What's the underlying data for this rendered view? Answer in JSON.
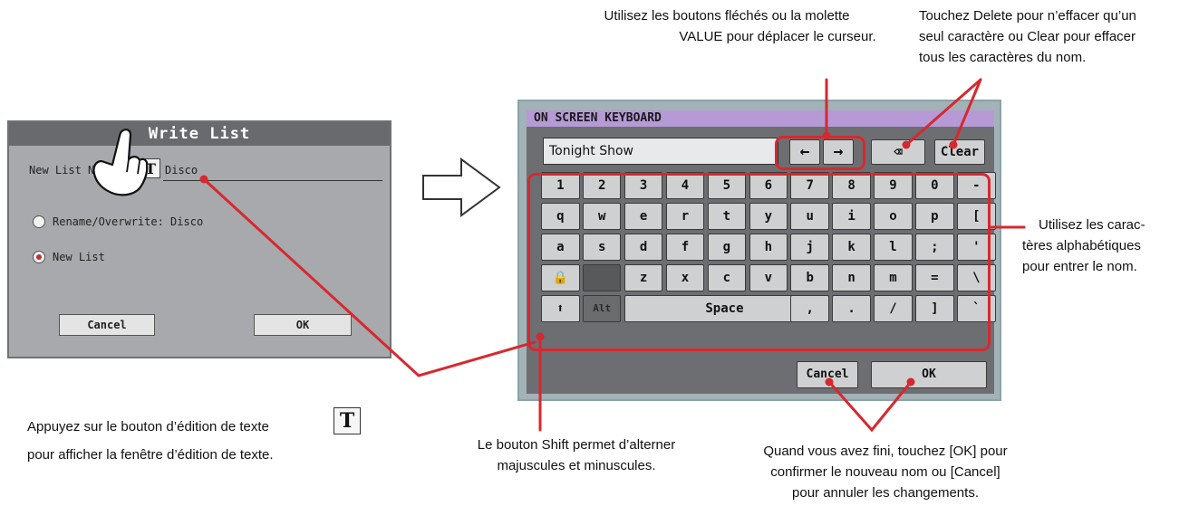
{
  "write_list": {
    "title": "Write List",
    "new_list_name_label": "New List Name:",
    "text_edit_glyph": "T",
    "name_value": "Disco",
    "option_rename": "Rename/Overwrite: Disco",
    "option_new_list": "New List",
    "cancel_label": "Cancel",
    "ok_label": "OK",
    "selected_option": "New List"
  },
  "keyboard": {
    "title": "ON SCREEN KEYBOARD",
    "field_value": "Tonight Show",
    "left_arrow": "←",
    "right_arrow": "→",
    "delete_glyph": "⌫",
    "clear_label": "Clear",
    "row1": [
      "1",
      "2",
      "3",
      "4",
      "5",
      "6",
      "7",
      "8",
      "9",
      "0",
      "-"
    ],
    "row2": [
      "q",
      "w",
      "e",
      "r",
      "t",
      "y",
      "u",
      "i",
      "o",
      "p",
      "["
    ],
    "row3": [
      "a",
      "s",
      "d",
      "f",
      "g",
      "h",
      "j",
      "k",
      "l",
      ";",
      "'"
    ],
    "row4": [
      "z",
      "x",
      "c",
      "v",
      "b",
      "n",
      "m",
      "=",
      "\\"
    ],
    "lock_glyph": "🔒",
    "shift_glyph": "⬆",
    "alt_label": "Alt",
    "space_label": "Space",
    "row5_right": [
      ",",
      ".",
      "/",
      "]",
      "`"
    ],
    "cancel_label": "Cancel",
    "ok_label": "OK"
  },
  "annotations": {
    "arrows_note_1": "Utilisez les boutons fléchés ou la molette",
    "arrows_note_2": "VALUE pour déplacer le curseur.",
    "delete_note_1": "Touchez Delete pour n’effacer qu’un",
    "delete_note_2": "seul caractère ou Clear pour effacer",
    "delete_note_3": "tous les caractères du nom.",
    "alpha_note_1": "Utilisez les carac-",
    "alpha_note_2": "tères alphabétiques",
    "alpha_note_3": "pour entrer le nom.",
    "tbtn_note_1": "Appuyez sur le bouton d’édition de texte",
    "tbtn_note_2": "pour afficher la fenêtre d’édition de texte.",
    "tbtn_icon": "T",
    "shift_note_1": "Le bouton Shift permet d’alterner",
    "shift_note_2": "majuscules et minuscules.",
    "done_note_1": "Quand vous avez fini, touchez [OK] pour",
    "done_note_2": "confirmer le nouveau nom ou [Cancel]",
    "done_note_3": "pour annuler les changements."
  },
  "colors": {
    "annotation_red": "#d7282f",
    "osk_title_bar": "#b69ad6",
    "dialog_title_bar": "#686a6e"
  }
}
